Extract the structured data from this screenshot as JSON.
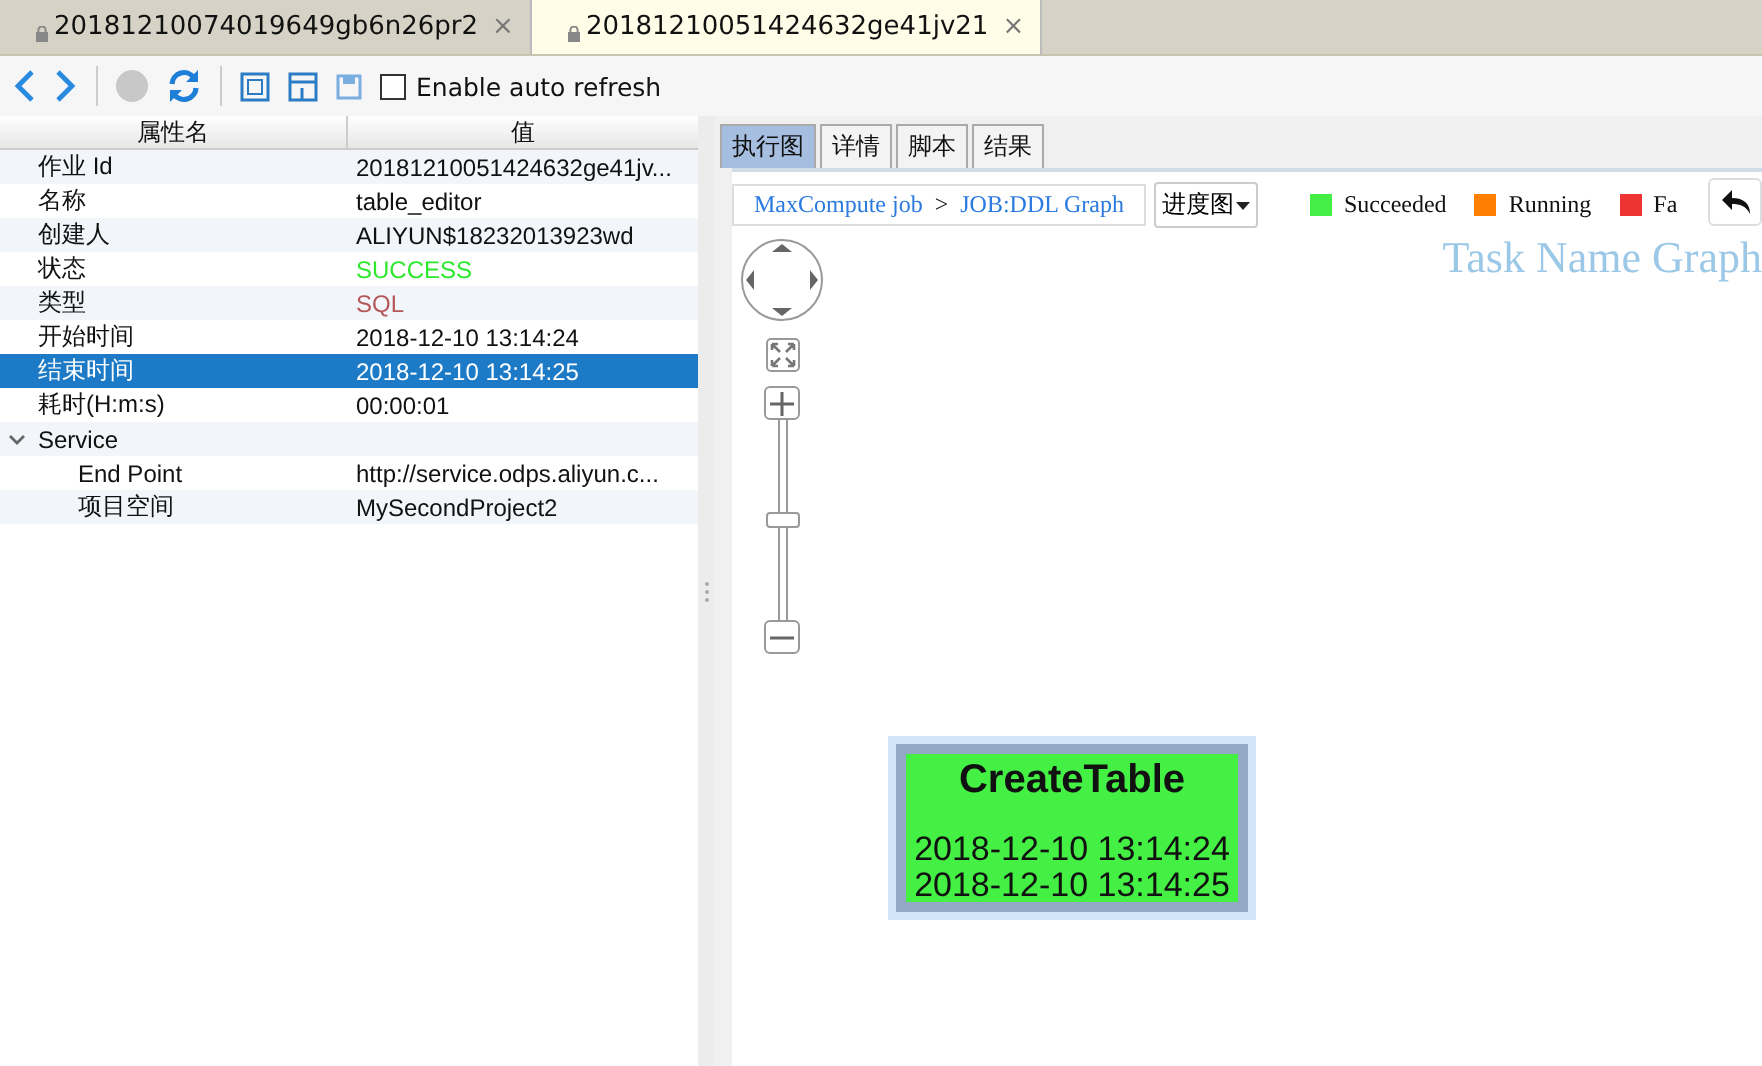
{
  "doc_tabs": [
    {
      "label": "20181210074019649gb6n26pr2",
      "close": "×",
      "selected": false
    },
    {
      "label": "20181210051424632ge41jv21",
      "close": "×",
      "selected": true
    }
  ],
  "toolbar": {
    "auto_refresh": {
      "label": "Enable auto refresh",
      "checked": false
    }
  },
  "properties": {
    "columns": [
      "属性名",
      "值"
    ],
    "rows": [
      {
        "name": "作业 Id",
        "value": "20181210051424632ge41jv...",
        "selected": false
      },
      {
        "name": "名称",
        "value": "table_editor",
        "selected": false
      },
      {
        "name": "创建人",
        "value": "ALIYUN$18232013923wd",
        "selected": false
      },
      {
        "name": "状态",
        "value": "SUCCESS",
        "color": "#2ee82e",
        "selected": false
      },
      {
        "name": "类型",
        "value": "SQL",
        "color": "#b5585a",
        "selected": false
      },
      {
        "name": "开始时间",
        "value": "2018-12-10 13:14:24",
        "selected": false
      },
      {
        "name": "结束时间",
        "value": "2018-12-10 13:14:25",
        "selected": true
      },
      {
        "name": "耗时(H:m:s)",
        "value": "00:00:01",
        "selected": false
      },
      {
        "name": "Service",
        "expanded": true,
        "selected": false,
        "children": [
          {
            "name": "End Point",
            "value": "http://service.odps.aliyun.c...",
            "selected": false
          },
          {
            "name": "项目空间",
            "value": "MySecondProject2",
            "selected": false
          }
        ]
      }
    ]
  },
  "view_tabs": [
    {
      "label": "执行图",
      "selected": true
    },
    {
      "label": "详情",
      "selected": false
    },
    {
      "label": "脚本",
      "selected": false
    },
    {
      "label": "结果",
      "selected": false
    }
  ],
  "graph": {
    "breadcrumb": [
      "MaxCompute job",
      "JOB:DDL Graph"
    ],
    "separator": ">",
    "view_menu": "进度图",
    "legend": [
      {
        "label": "Succeeded",
        "color": "#44ee44"
      },
      {
        "label": "Running",
        "color": "#ff7f00"
      },
      {
        "label": "Fa",
        "color": "#ee3333"
      }
    ],
    "watermark": "Task Name Graph",
    "zoom": {
      "level": 0.5
    },
    "node": {
      "title": "CreateTable",
      "start": "2018-12-10 13:14:24",
      "end": "2018-12-10 13:14:25",
      "color": "#44f044"
    }
  }
}
